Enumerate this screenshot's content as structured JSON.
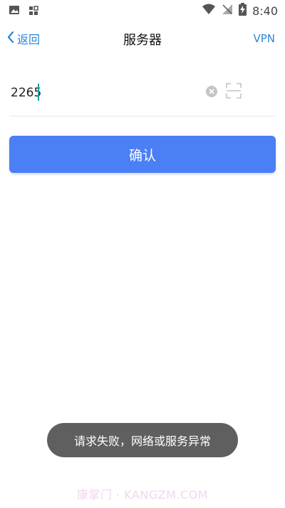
{
  "status_bar": {
    "time": "8:40",
    "left_icons": [
      "image-icon",
      "qr-grid-icon"
    ],
    "right_icons": [
      "wifi-icon",
      "no-signal-icon",
      "battery-charging-icon"
    ]
  },
  "nav": {
    "back_label": "返回",
    "title": "服务器",
    "right_link": "VPN"
  },
  "form": {
    "server_value": "2265",
    "placeholder": ""
  },
  "confirm": {
    "label": "确认"
  },
  "toast": {
    "message": "请求失败，网络或服务异常"
  },
  "watermark": {
    "text": "康掌门 · KANGZM.COM"
  },
  "colors": {
    "accent": "#2a86d8",
    "button": "#4b7ff5",
    "toast_bg": "#5f5f5f"
  }
}
